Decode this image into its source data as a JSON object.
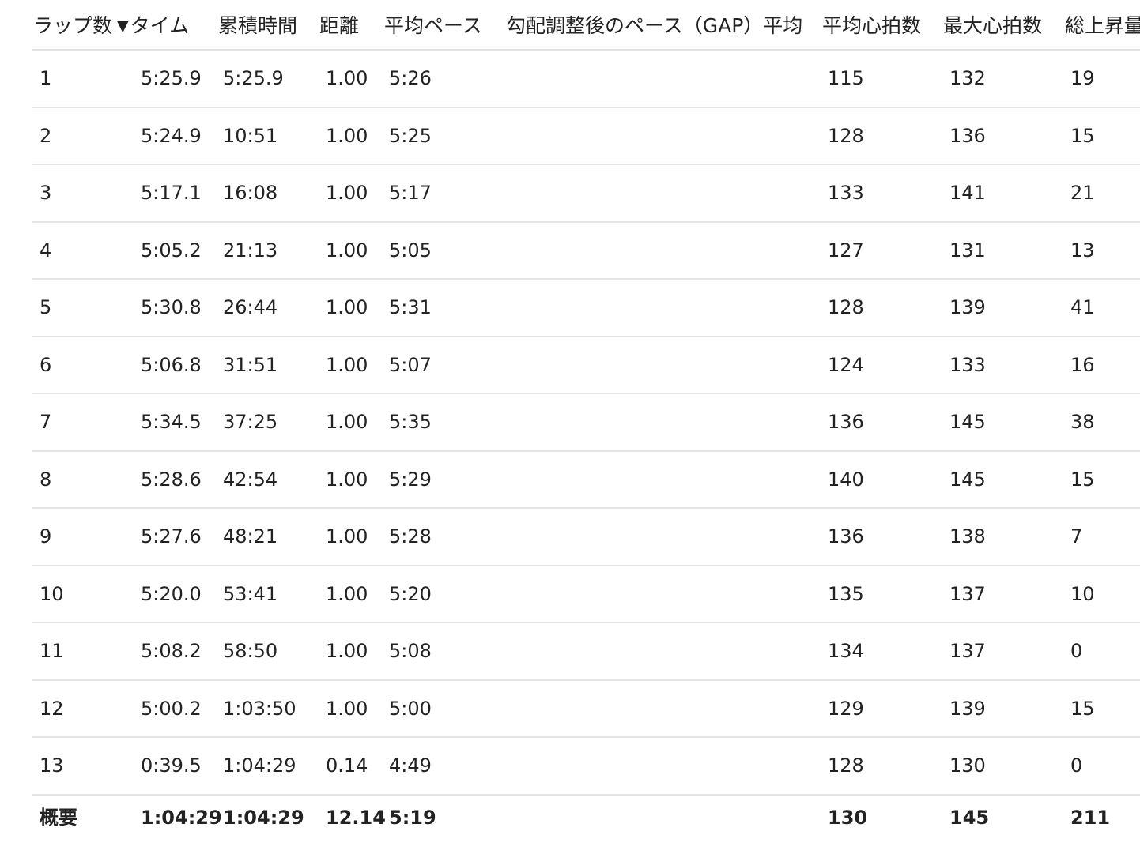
{
  "table": {
    "headers": {
      "lap": "ラップ数",
      "sort_icon": "▼",
      "time": "タイム",
      "cumulative": "累積時間",
      "distance": "距離",
      "avg_pace": "平均ペース",
      "gap": "勾配調整後のペース（GAP）平均",
      "avg_hr": "平均心拍数",
      "max_hr": "最大心拍数",
      "elevation": "総上昇量"
    },
    "rows": [
      {
        "lap": "1",
        "time": "5:25.9",
        "cumulative": "5:25.9",
        "distance": "1.00",
        "avg_pace": "5:26",
        "gap": "",
        "avg_hr": "115",
        "max_hr": "132",
        "elevation": "19"
      },
      {
        "lap": "2",
        "time": "5:24.9",
        "cumulative": "10:51",
        "distance": "1.00",
        "avg_pace": "5:25",
        "gap": "",
        "avg_hr": "128",
        "max_hr": "136",
        "elevation": "15"
      },
      {
        "lap": "3",
        "time": "5:17.1",
        "cumulative": "16:08",
        "distance": "1.00",
        "avg_pace": "5:17",
        "gap": "",
        "avg_hr": "133",
        "max_hr": "141",
        "elevation": "21"
      },
      {
        "lap": "4",
        "time": "5:05.2",
        "cumulative": "21:13",
        "distance": "1.00",
        "avg_pace": "5:05",
        "gap": "",
        "avg_hr": "127",
        "max_hr": "131",
        "elevation": "13"
      },
      {
        "lap": "5",
        "time": "5:30.8",
        "cumulative": "26:44",
        "distance": "1.00",
        "avg_pace": "5:31",
        "gap": "",
        "avg_hr": "128",
        "max_hr": "139",
        "elevation": "41"
      },
      {
        "lap": "6",
        "time": "5:06.8",
        "cumulative": "31:51",
        "distance": "1.00",
        "avg_pace": "5:07",
        "gap": "",
        "avg_hr": "124",
        "max_hr": "133",
        "elevation": "16"
      },
      {
        "lap": "7",
        "time": "5:34.5",
        "cumulative": "37:25",
        "distance": "1.00",
        "avg_pace": "5:35",
        "gap": "",
        "avg_hr": "136",
        "max_hr": "145",
        "elevation": "38"
      },
      {
        "lap": "8",
        "time": "5:28.6",
        "cumulative": "42:54",
        "distance": "1.00",
        "avg_pace": "5:29",
        "gap": "",
        "avg_hr": "140",
        "max_hr": "145",
        "elevation": "15"
      },
      {
        "lap": "9",
        "time": "5:27.6",
        "cumulative": "48:21",
        "distance": "1.00",
        "avg_pace": "5:28",
        "gap": "",
        "avg_hr": "136",
        "max_hr": "138",
        "elevation": "7"
      },
      {
        "lap": "10",
        "time": "5:20.0",
        "cumulative": "53:41",
        "distance": "1.00",
        "avg_pace": "5:20",
        "gap": "",
        "avg_hr": "135",
        "max_hr": "137",
        "elevation": "10"
      },
      {
        "lap": "11",
        "time": "5:08.2",
        "cumulative": "58:50",
        "distance": "1.00",
        "avg_pace": "5:08",
        "gap": "",
        "avg_hr": "134",
        "max_hr": "137",
        "elevation": "0"
      },
      {
        "lap": "12",
        "time": "5:00.2",
        "cumulative": "1:03:50",
        "distance": "1.00",
        "avg_pace": "5:00",
        "gap": "",
        "avg_hr": "129",
        "max_hr": "139",
        "elevation": "15"
      },
      {
        "lap": "13",
        "time": "0:39.5",
        "cumulative": "1:04:29",
        "distance": "0.14",
        "avg_pace": "4:49",
        "gap": "",
        "avg_hr": "128",
        "max_hr": "130",
        "elevation": "0"
      }
    ],
    "summary": {
      "lap": "概要",
      "time": "1:04:29",
      "cumulative": "1:04:29",
      "distance": "12.14",
      "avg_pace": "5:19",
      "avg_hr": "130",
      "max_hr": "145",
      "elevation": "211"
    }
  }
}
